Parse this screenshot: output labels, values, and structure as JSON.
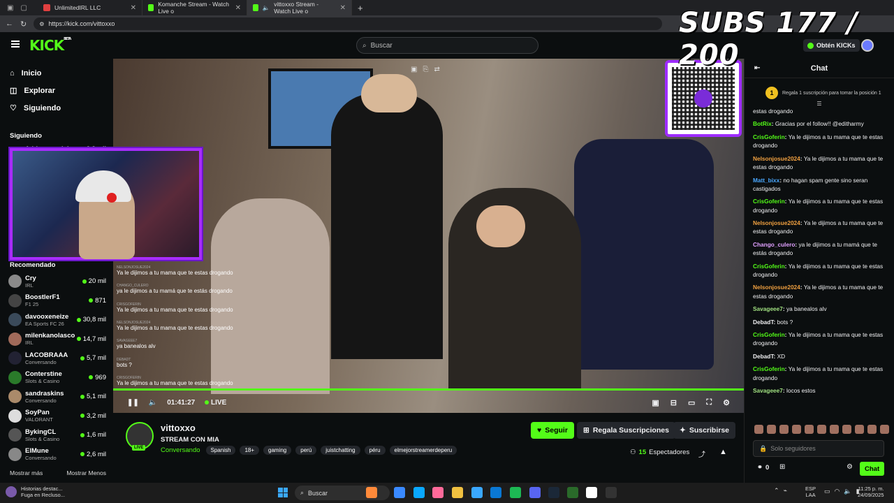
{
  "browser": {
    "tabs": [
      {
        "title": "UnlimitedIRL LLC",
        "color": "#e04040"
      },
      {
        "title": "Komanche Stream - Watch Live o",
        "color": "#53fc18"
      },
      {
        "title": "vittoxxo Stream - Watch Live o",
        "color": "#53fc18"
      }
    ],
    "url": "https://kick.com/vittoxxo"
  },
  "header": {
    "logo": "KICK",
    "logo_badge": "BETA",
    "search_placeholder": "Buscar",
    "kicks_label": "Obtén KICKs"
  },
  "overlay": {
    "subs_text": "SUBS 177 / 200"
  },
  "sidebar": {
    "nav": [
      {
        "label": "Inicio",
        "icon": "home-icon"
      },
      {
        "label": "Explorar",
        "icon": "compass-icon"
      },
      {
        "label": "Siguiendo",
        "icon": "heart-icon"
      }
    ],
    "following_title": "Siguiendo",
    "following_partial": {
      "name": "Adrianozandola",
      "viewers": "9,8 mil"
    },
    "recommended_title": "Recomendado",
    "recommended": [
      {
        "name": "Cry",
        "category": "IRL",
        "viewers": "20 mil",
        "color": "#8a8a8a"
      },
      {
        "name": "BoostlerF1",
        "category": "F1 25",
        "viewers": "871",
        "color": "#444"
      },
      {
        "name": "davooxeneize",
        "category": "EA Sports FC 26",
        "viewers": "30,8 mil",
        "color": "#3a4a5a"
      },
      {
        "name": "milenkanolasco",
        "category": "IRL",
        "viewers": "14,7 mil",
        "color": "#a06a5a"
      },
      {
        "name": "LACOBRAAA",
        "category": "Conversando",
        "viewers": "5,7 mil",
        "color": "#223"
      },
      {
        "name": "Conterstine",
        "category": "Slots & Casino",
        "viewers": "969",
        "color": "#2a7a2a"
      },
      {
        "name": "sandraskins",
        "category": "Conversando",
        "viewers": "5,1 mil",
        "color": "#aa8a6a"
      },
      {
        "name": "SoyPan",
        "category": "VALORANT",
        "viewers": "3,2 mil",
        "color": "#ddd"
      },
      {
        "name": "BykingCL",
        "category": "Slots & Casino",
        "viewers": "1,6 mil",
        "color": "#555"
      },
      {
        "name": "ElMune",
        "category": "Conversando",
        "viewers": "2,6 mil",
        "color": "#888"
      }
    ],
    "show_more": "Mostrar más",
    "show_less": "Mostrar Menos"
  },
  "video_overlay_chat": [
    {
      "user": "NELSONJOSUE2024",
      "msg": "Ya le dijimos a tu mama que te estas drogando"
    },
    {
      "user": "CHANGO_CULERO",
      "msg": "ya le dijimos a tu mamá que te estás drogando"
    },
    {
      "user": "CRISGOFERIN",
      "msg": "Ya le dijimos a tu mama que te estas drogando"
    },
    {
      "user": "NELSONJOSUE2024",
      "msg": "Ya le dijimos a tu mama que te estas drogando"
    },
    {
      "user": "SAVAGEEE7",
      "msg": "ya banealos alv"
    },
    {
      "user": "DEBADT",
      "msg": "bots ?"
    },
    {
      "user": "CRISGOFERIN",
      "msg": "Ya le dijimos a tu mama que te estas drogando"
    }
  ],
  "player": {
    "time": "01:41:27",
    "live": "LIVE"
  },
  "stream": {
    "channel": "vittoxxo",
    "live_badge": "LIVE",
    "title": "STREAM CON MIA",
    "category": "Conversando",
    "tags": [
      "Spanish",
      "18+",
      "gaming",
      "perú",
      "juistchatting",
      "péru",
      "elmejorstreamerdeperu"
    ],
    "follow": "Seguir",
    "gift": "Regala Suscripciones",
    "subscribe": "Suscribirse",
    "viewers_count": "15",
    "viewers_label": "Espectadores"
  },
  "chat": {
    "title": "Chat",
    "pinned_rank": "1",
    "pinned_text": "Regala 1 suscripción para tomar la posición 1",
    "messages": [
      {
        "user": "",
        "text": "estas drogando",
        "color": "#efeff1"
      },
      {
        "user": "BotRix",
        "text": "Gracias por el follow!! @editharmy",
        "color": "#53fc18"
      },
      {
        "user": "CrisGoferin",
        "text": "Ya le dijimos a tu mama que te estas drogando",
        "color": "#53fc18"
      },
      {
        "user": "Nelsonjosue2024",
        "text": "Ya le dijimos a tu mama que te estas drogando",
        "color": "#f0a040"
      },
      {
        "user": "Matt_bixx",
        "text": "no hagan spam gente sino seran castigados",
        "color": "#4aa8ff"
      },
      {
        "user": "CrisGoferin",
        "text": "Ya le dijimos a tu mama que te estas drogando",
        "color": "#53fc18"
      },
      {
        "user": "Nelsonjosue2024",
        "text": "Ya le dijimos a tu mama que te estas drogando",
        "color": "#f0a040"
      },
      {
        "user": "Chango_culero",
        "text": "ya le dijimos a tu mamá que te estás drogando",
        "color": "#e0a0ff"
      },
      {
        "user": "CrisGoferin",
        "text": "Ya le dijimos a tu mama que te estas drogando",
        "color": "#53fc18"
      },
      {
        "user": "Nelsonjosue2024",
        "text": "Ya le dijimos a tu mama que te estas drogando",
        "color": "#f0a040"
      },
      {
        "user": "Savageee7",
        "text": "ya banealos alv",
        "color": "#a0e080"
      },
      {
        "user": "DebadT",
        "text": "bots ?",
        "color": "#efeff1"
      },
      {
        "user": "CrisGoferin",
        "text": "Ya le dijimos a tu mama que te estas drogando",
        "color": "#53fc18"
      },
      {
        "user": "DebadT",
        "text": "XD",
        "color": "#efeff1"
      },
      {
        "user": "CrisGoferin",
        "text": "Ya le dijimos a tu mama que te estas drogando",
        "color": "#53fc18"
      },
      {
        "user": "Savageee7",
        "text": "locos estos",
        "color": "#a0e080"
      }
    ],
    "input_placeholder": "Solo seguidores",
    "points": "0",
    "send": "Chat"
  },
  "taskbar": {
    "notification_title": "Historias destac...",
    "notification_sub": "Fuga en Recluso...",
    "search": "Buscar",
    "lang1": "ESP",
    "lang2": "LAA",
    "time": "11:25 p. m.",
    "date": "24/09/2025"
  }
}
